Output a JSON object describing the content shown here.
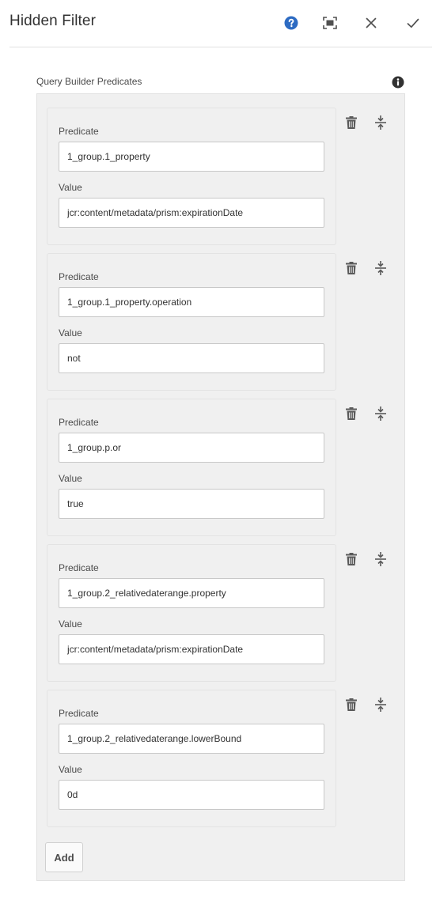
{
  "dialog": {
    "title": "Hidden Filter"
  },
  "header_actions": [
    {
      "name": "help",
      "icon": "help-icon",
      "color": "#2d6bc2"
    },
    {
      "name": "fullscreen",
      "icon": "fullscreen-icon"
    },
    {
      "name": "close",
      "icon": "close-icon"
    },
    {
      "name": "done",
      "icon": "checkmark-icon"
    }
  ],
  "multifield": {
    "label": "Query Builder Predicates",
    "info_icon": "info-icon",
    "predicate_label": "Predicate",
    "value_label": "Value",
    "add_label": "Add",
    "items": [
      {
        "predicate": "1_group.1_property",
        "value": "jcr:content/metadata/prism:expirationDate"
      },
      {
        "predicate": "1_group.1_property.operation",
        "value": "not"
      },
      {
        "predicate": "1_group.p.or",
        "value": "true"
      },
      {
        "predicate": "1_group.2_relativedaterange.property",
        "value": "jcr:content/metadata/prism:expirationDate"
      },
      {
        "predicate": "1_group.2_relativedaterange.lowerBound",
        "value": "0d"
      }
    ]
  },
  "colors": {
    "accent": "#2d6bc2",
    "panel_bg": "#f0f0f0",
    "icon": "#6e6e6e"
  }
}
